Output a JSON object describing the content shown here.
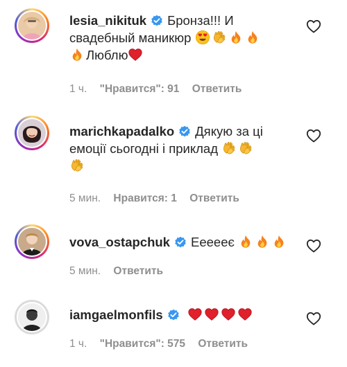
{
  "comments": [
    {
      "username": "lesia_nikituk",
      "verified": true,
      "text_parts": [
        "Бронза!!! И свадебный маникюр",
        "Люблю"
      ],
      "time": "1 ч.",
      "likes": "\"Нравится\": 91",
      "reply": "Ответить",
      "icons": [
        "verified-badge-icon",
        "heart-eyes-emoji",
        "clapping-hands-emoji",
        "fire-emoji",
        "red-heart-emoji",
        "like-heart-icon"
      ]
    },
    {
      "username": "marichkapadalko",
      "verified": true,
      "text_parts": [
        "Дякую за ці емоції сьогодні і приклад"
      ],
      "time": "5 мин.",
      "likes": "Нравится: 1",
      "reply": "Ответить",
      "icons": [
        "verified-badge-icon",
        "clapping-hands-emoji",
        "like-heart-icon"
      ]
    },
    {
      "username": "vova_ostapchuk",
      "verified": true,
      "text_parts": [
        "Еееееє"
      ],
      "time": "5 мин.",
      "reply": "Ответить",
      "icons": [
        "verified-badge-icon",
        "fire-emoji",
        "like-heart-icon"
      ]
    },
    {
      "username": "iamgaelmonfils",
      "verified": true,
      "text_parts": [],
      "time": "1 ч.",
      "likes": "\"Нравится\": 575",
      "reply": "Ответить",
      "icons": [
        "verified-badge-icon",
        "red-heart-emoji",
        "like-heart-icon"
      ]
    }
  ],
  "colors": {
    "verified_blue": "#3897f0",
    "meta_gray": "#8e8e8e",
    "text": "#262626",
    "emoji_heart_red": "#e0202c",
    "emoji_fire_orange": "#f58220",
    "emoji_clap_yellow": "#f7b731"
  }
}
